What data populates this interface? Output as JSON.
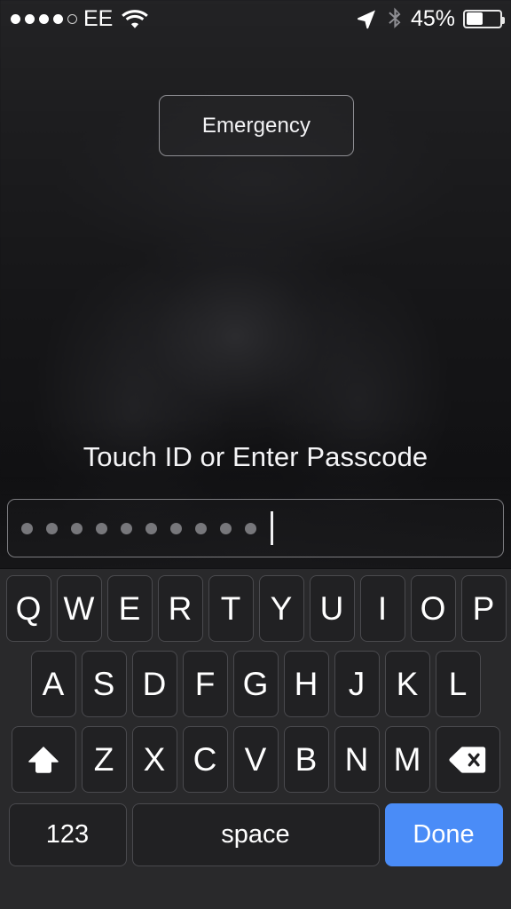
{
  "status_bar": {
    "signal_dots_total": 5,
    "signal_dots_filled": 4,
    "carrier": "EE",
    "wifi_icon": "wifi-icon",
    "location_icon": "location-arrow-icon",
    "bluetooth_icon": "bluetooth-icon",
    "battery_percent_label": "45%",
    "battery_level": 45
  },
  "emergency": {
    "label": "Emergency"
  },
  "lock": {
    "prompt": "Touch ID or Enter Passcode"
  },
  "passcode": {
    "dot_count": 10,
    "cursor_visible": true,
    "placeholder": ""
  },
  "keyboard": {
    "row1": [
      "Q",
      "W",
      "E",
      "R",
      "T",
      "Y",
      "U",
      "I",
      "O",
      "P"
    ],
    "row2": [
      "A",
      "S",
      "D",
      "F",
      "G",
      "H",
      "J",
      "K",
      "L"
    ],
    "row3": [
      "Z",
      "X",
      "C",
      "V",
      "B",
      "N",
      "M"
    ],
    "shift_icon": "shift-arrow-icon",
    "backspace_icon": "backspace-delete-icon",
    "numbers_label": "123",
    "space_label": "space",
    "done_label": "Done"
  },
  "colors": {
    "accent_blue": "#4a8cf7",
    "key_face": "#212123",
    "key_border": "#4a4a4e",
    "keyboard_bg": "#29292b",
    "text_white": "#ffffff",
    "dot_gray": "#77777b"
  }
}
